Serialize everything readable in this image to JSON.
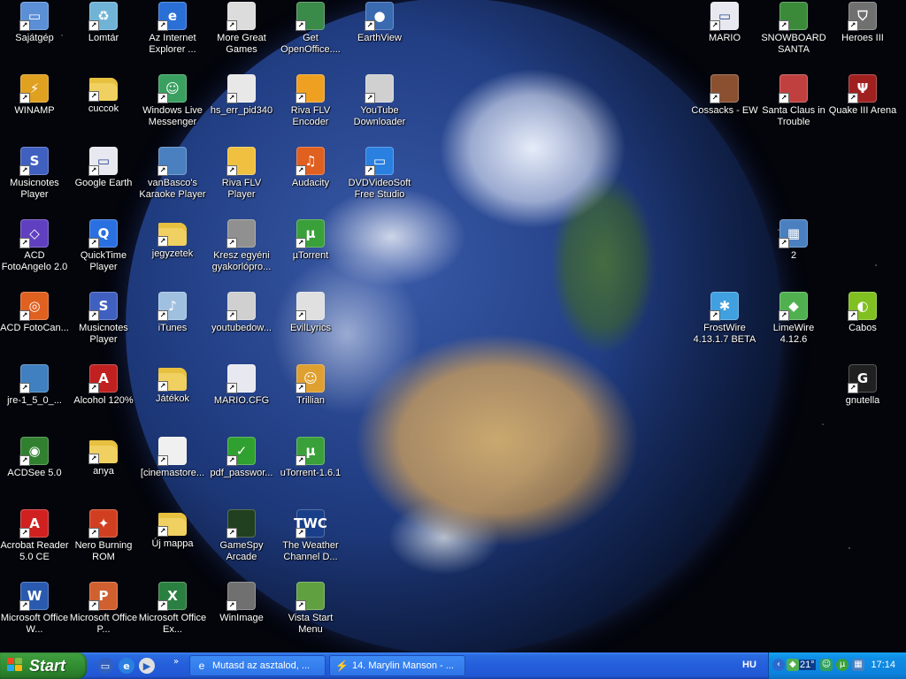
{
  "desktop": {
    "icons": [
      {
        "label": "Sajátgép",
        "icon": "my-computer-icon",
        "color": "#5b8fd6"
      },
      {
        "label": "Lomtár",
        "icon": "recycle-bin-icon",
        "color": "#6fb3d6"
      },
      {
        "label": "Az Internet Explorer ...",
        "icon": "internet-explorer-icon",
        "color": "#2a6fd6"
      },
      {
        "label": "More Great Games",
        "icon": "document-icon",
        "color": "#dcdcdc"
      },
      {
        "label": "Get OpenOffice....",
        "icon": "openoffice-icon",
        "color": "#3a8a4a"
      },
      {
        "label": "EarthView",
        "icon": "globe-icon",
        "color": "#3a6ab0"
      },
      {
        "label": "MARIO",
        "icon": "window-icon",
        "color": "#e8e8f0"
      },
      {
        "label": "SNOWBOARD SANTA",
        "icon": "game-icon",
        "color": "#3a8a3a"
      },
      {
        "label": "Heroes III",
        "icon": "heroes-icon",
        "color": "#707070"
      },
      {
        "label": "WINAMP",
        "icon": "winamp-icon",
        "color": "#e0a020"
      },
      {
        "label": "cuccok",
        "icon": "folder-icon",
        "color": "#f0d060"
      },
      {
        "label": "Windows Live Messenger",
        "icon": "messenger-icon",
        "color": "#3aa060"
      },
      {
        "label": "hs_err_pid340",
        "icon": "text-file-icon",
        "color": "#e8e8e8"
      },
      {
        "label": "Riva FLV Encoder",
        "icon": "encoder-icon",
        "color": "#f0a020"
      },
      {
        "label": "YouTube Downloader",
        "icon": "downloader-icon",
        "color": "#d0d0d0"
      },
      {
        "label": "Cossacks - EW",
        "icon": "cossacks-icon",
        "color": "#8a5030"
      },
      {
        "label": "Santa Claus in Trouble",
        "icon": "santa-icon",
        "color": "#c04040"
      },
      {
        "label": "Quake III Arena",
        "icon": "quake-icon",
        "color": "#a02020"
      },
      {
        "label": "Musicnotes Player",
        "icon": "musicnotes-icon",
        "color": "#4060c0"
      },
      {
        "label": "Google Earth",
        "icon": "window-icon",
        "color": "#e8e8f0"
      },
      {
        "label": "vanBasco's Karaoke Player",
        "icon": "karaoke-icon",
        "color": "#4a80c0"
      },
      {
        "label": "Riva FLV Player",
        "icon": "player-icon",
        "color": "#f0c040"
      },
      {
        "label": "Audacity",
        "icon": "audacity-icon",
        "color": "#e06020"
      },
      {
        "label": "DVDVideoSoft Free Studio",
        "icon": "monitor-icon",
        "color": "#2a80e0"
      },
      {
        "label": "ACD FotoAngelo 2.0",
        "icon": "acd-icon",
        "color": "#6040c0"
      },
      {
        "label": "QuickTime Player",
        "icon": "quicktime-icon",
        "color": "#2a70e0"
      },
      {
        "label": "jegyzetek",
        "icon": "folder-icon",
        "color": "#f0d060"
      },
      {
        "label": "Kresz egyéni gyakorlópro...",
        "icon": "program-icon",
        "color": "#909090"
      },
      {
        "label": "µTorrent",
        "icon": "utorrent-icon",
        "color": "#3aa03a"
      },
      {
        "label": "2",
        "icon": "network-icon",
        "color": "#4a80c0"
      },
      {
        "label": "ACD FotoCan...",
        "icon": "acd-canvas-icon",
        "color": "#e06020"
      },
      {
        "label": "Musicnotes Player",
        "icon": "musicnotes-icon",
        "color": "#4060c0"
      },
      {
        "label": "iTunes",
        "icon": "itunes-icon",
        "color": "#a0c0e0"
      },
      {
        "label": "youtubedow...",
        "icon": "download-icon",
        "color": "#d0d0d0"
      },
      {
        "label": "EvilLyrics",
        "icon": "evillyrics-icon",
        "color": "#e0e0e0"
      },
      {
        "label": "FrostWire 4.13.1.7 BETA",
        "icon": "frostwire-icon",
        "color": "#40a0e0"
      },
      {
        "label": "LimeWire 4.12.6",
        "icon": "limewire-icon",
        "color": "#50b050"
      },
      {
        "label": "Cabos",
        "icon": "cabos-icon",
        "color": "#80c020"
      },
      {
        "label": "jre-1_5_0_...",
        "icon": "installer-icon",
        "color": "#4080c0"
      },
      {
        "label": "Alcohol 120%",
        "icon": "alcohol-icon",
        "color": "#c02020"
      },
      {
        "label": "Játékok",
        "icon": "folder-icon",
        "color": "#f0d060"
      },
      {
        "label": "MARIO.CFG",
        "icon": "config-file-icon",
        "color": "#e8e8f0"
      },
      {
        "label": "Trillian",
        "icon": "trillian-icon",
        "color": "#e0a030"
      },
      {
        "label": "gnutella",
        "icon": "gnutella-icon",
        "color": "#202020"
      },
      {
        "label": "ACDSee 5.0",
        "icon": "acdsee-icon",
        "color": "#308030"
      },
      {
        "label": "anya",
        "icon": "folder-icon",
        "color": "#f0d060"
      },
      {
        "label": "[cinemastore...",
        "icon": "utorrent-file-icon",
        "color": "#f0f0f0"
      },
      {
        "label": "pdf_passwor...",
        "icon": "pdf-password-icon",
        "color": "#30a030"
      },
      {
        "label": "uTorrent-1.6.1",
        "icon": "utorrent-icon",
        "color": "#3aa03a"
      },
      {
        "label": "Acrobat Reader 5.0 CE",
        "icon": "acrobat-icon",
        "color": "#d02020"
      },
      {
        "label": "Nero Burning ROM",
        "icon": "nero-icon",
        "color": "#d04020"
      },
      {
        "label": "Új mappa",
        "icon": "folder-icon",
        "color": "#f0d060"
      },
      {
        "label": "GameSpy Arcade",
        "icon": "gamespy-icon",
        "color": "#204020"
      },
      {
        "label": "The Weather Channel D...",
        "icon": "weather-channel-icon",
        "color": "#1a3f8a"
      },
      {
        "label": "Microsoft Office W...",
        "icon": "word-icon",
        "color": "#2a5ab0"
      },
      {
        "label": "Microsoft Office P...",
        "icon": "powerpoint-icon",
        "color": "#d06030"
      },
      {
        "label": "Microsoft Office Ex...",
        "icon": "excel-icon",
        "color": "#2a8040"
      },
      {
        "label": "WinImage",
        "icon": "winimage-icon",
        "color": "#707070"
      },
      {
        "label": "Vista Start Menu",
        "icon": "vista-start-icon",
        "color": "#60a040"
      }
    ]
  },
  "taskbar": {
    "start_label": "Start",
    "quick_launch": [
      {
        "icon": "desktop-icon",
        "color": "#3060c0"
      },
      {
        "icon": "internet-explorer-icon",
        "color": "#2a80e0"
      },
      {
        "icon": "media-player-icon",
        "color": "#e0e0e0"
      }
    ],
    "quick_launch_more": "»",
    "tasks": [
      {
        "label": "Mutasd az asztalod, ...",
        "icon": "internet-explorer-icon"
      },
      {
        "label": "14. Marylin Manson - ...",
        "icon": "winamp-icon"
      }
    ],
    "language": "HU",
    "tray": {
      "temperature": "21°",
      "clock": "17:14",
      "icons": [
        "chevron-left-icon",
        "limewire-tray-icon",
        "weather-tray-icon",
        "messenger-tray-icon",
        "utorrent-tray-icon",
        "network-tray-icon"
      ]
    }
  }
}
